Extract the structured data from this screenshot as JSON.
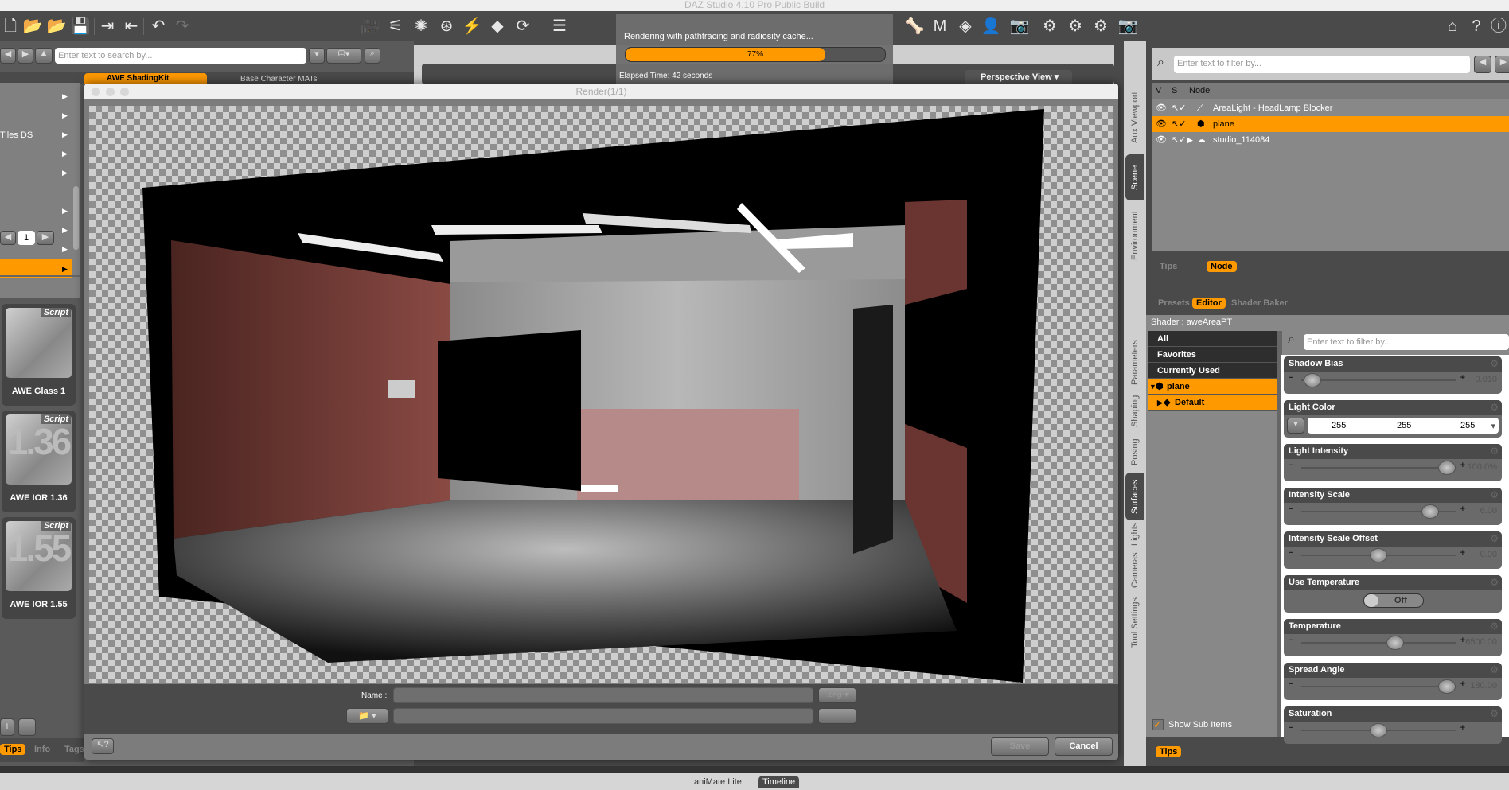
{
  "app": {
    "title": "DAZ Studio 4.10 Pro Public Build"
  },
  "toolbar": {
    "left_icons": [
      "new-icon",
      "open-icon",
      "merge-icon",
      "save-icon",
      "import-icon",
      "export-icon",
      "undo-icon",
      "redo-icon"
    ],
    "mid_icons": [
      "new-camera-icon",
      "spotlight-icon",
      "point-light-icon",
      "distant-light-icon",
      "light-icon",
      "primitive-icon",
      "transform-icon",
      "align-icon"
    ],
    "right_icons": [
      "joint-editor-icon",
      "morph-icon",
      "geometry-editor-icon",
      "figure-icon",
      "camera-tool-icon",
      "node-select-icon",
      "render-settings-icon",
      "render-setup-icon",
      "render-icon"
    ],
    "far_right": [
      "daz-home-icon",
      "whats-this-icon",
      "help-icon"
    ]
  },
  "left_panel": {
    "search_placeholder": "Enter text to search by...",
    "tabs": [
      "AWE ShadingKit",
      "Base Character MATs"
    ],
    "list_item": "Tiles DS",
    "page": "1",
    "cards": [
      {
        "badge": "Script",
        "label": "AWE Glass 1"
      },
      {
        "badge": "Script",
        "big": "1.36",
        "label": "AWE IOR 1.36"
      },
      {
        "badge": "Script",
        "big": "1.55",
        "label": "AWE IOR 1.55"
      }
    ],
    "bottom_tabs": [
      "Tips",
      "Info",
      "Tags"
    ]
  },
  "progress": {
    "status": "Rendering with pathtracing and radiosity cache...",
    "percent": 77,
    "percent_label": "77%",
    "elapsed": "Elapsed Time:  42 seconds"
  },
  "viewport": {
    "view_label": "Perspective View"
  },
  "render_window": {
    "title": "Render(1/1)",
    "name_label": "Name :",
    "name_value": "",
    "format": ".png",
    "path_value": "",
    "browse": "...",
    "save": "Save",
    "cancel": "Cancel"
  },
  "right_tabs_top": [
    "Aux Viewport",
    "Scene",
    "Environment"
  ],
  "right_tabs_bottom": [
    "Parameters",
    "Shaping",
    "Posing",
    "Surfaces",
    "Lights",
    "Cameras",
    "Tool Settings"
  ],
  "scene": {
    "filter_placeholder": "Enter text to filter by...",
    "columns": [
      "V",
      "S",
      "Node"
    ],
    "nodes": [
      {
        "name": "AreaLight - HeadLamp Blocker",
        "selected": false
      },
      {
        "name": "plane",
        "selected": true
      },
      {
        "name": "studio_114084",
        "selected": false
      }
    ],
    "bottom_tabs": [
      "Tips",
      "Node"
    ]
  },
  "surfaces": {
    "tabs": [
      "Presets",
      "Editor",
      "Shader Baker"
    ],
    "shader": "Shader : aweAreaPT",
    "groups": [
      "All",
      "Favorites",
      "Currently Used",
      "plane",
      "Default"
    ],
    "filter_placeholder": "Enter text to filter by...",
    "show_sub_items": "Show Sub Items",
    "bottom_tab": "Tips",
    "properties": [
      {
        "name": "Shadow Bias",
        "type": "slider",
        "value": "0.010",
        "fraction": 0.02
      },
      {
        "name": "Light Color",
        "type": "color",
        "r": "255",
        "g": "255",
        "b": "255"
      },
      {
        "name": "Light Intensity",
        "type": "slider",
        "value": "100.0%",
        "fraction": 1.0
      },
      {
        "name": "Intensity Scale",
        "type": "slider",
        "value": "6.00",
        "fraction": 0.88
      },
      {
        "name": "Intensity Scale Offset",
        "type": "slider",
        "value": "0.00",
        "fraction": 0.5
      },
      {
        "name": "Use Temperature",
        "type": "toggle",
        "value": "Off"
      },
      {
        "name": "Temperature",
        "type": "slider",
        "value": "6500.00",
        "fraction": 0.62
      },
      {
        "name": "Spread Angle",
        "type": "slider",
        "value": "180.00",
        "fraction": 1.0
      },
      {
        "name": "Saturation",
        "type": "slider",
        "value": "",
        "fraction": 0.5
      }
    ]
  },
  "bottom": {
    "tabs": [
      "aniMate Lite",
      "Timeline"
    ]
  },
  "colors": {
    "accent": "#ff9900",
    "panel": "#4a4a4a"
  }
}
